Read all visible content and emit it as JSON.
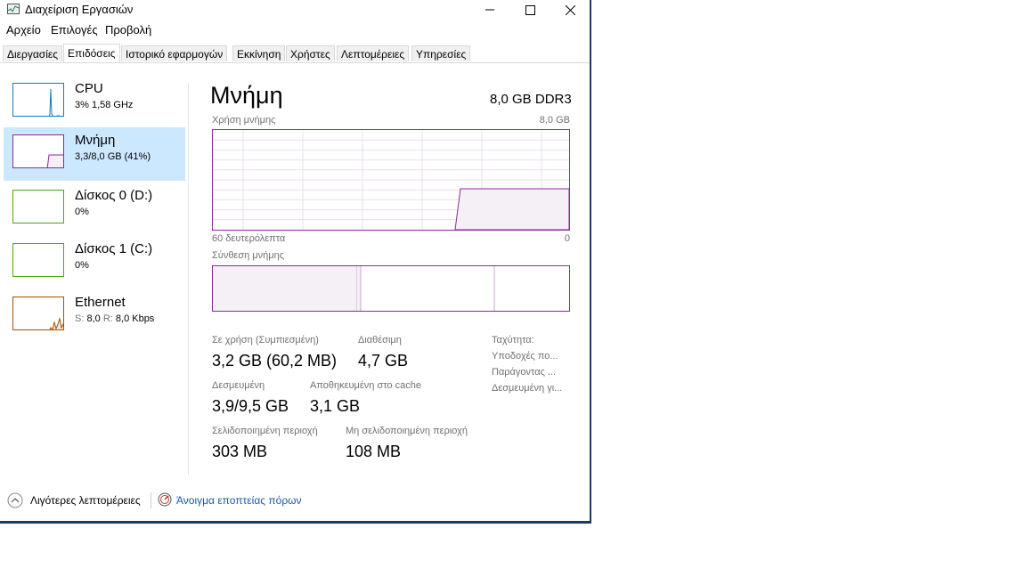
{
  "window": {
    "title": "Διαχείριση Εργασιών"
  },
  "menu": [
    "Αρχείο",
    "Επιλογές",
    "Προβολή"
  ],
  "tabs": [
    {
      "label": "Διεργασίες",
      "active": false
    },
    {
      "label": "Επιδόσεις",
      "active": true
    },
    {
      "label": "Ιστορικό εφαρμογών",
      "active": false
    },
    {
      "label": "Εκκίνηση",
      "active": false
    },
    {
      "label": "Χρήστες",
      "active": false
    },
    {
      "label": "Λεπτομέρειες",
      "active": false
    },
    {
      "label": "Υπηρεσίες",
      "active": false
    }
  ],
  "sidebar": {
    "items": [
      {
        "name": "CPU",
        "value": "3%  1,58 GHz",
        "color": "#117dbb"
      },
      {
        "name": "Μνήμη",
        "value": "3,3/8,0 GB (41%)",
        "color": "#8b2a9b",
        "selected": true
      },
      {
        "name": "Δίσκος 0 (D:)",
        "value": "0%",
        "color": "#4da60c"
      },
      {
        "name": "Δίσκος 1 (C:)",
        "value": "0%",
        "color": "#4da60c"
      },
      {
        "name": "Ethernet",
        "value_s_label": "S:",
        "value_s": "8,0",
        "value_r_label": "R:",
        "value_r": "8,0 Kbps",
        "color": "#a74f01"
      }
    ]
  },
  "main": {
    "title": "Μνήμη",
    "subtitle": "8,0 GB DDR3",
    "usage_label": "Χρήση μνήμης",
    "usage_max": "8,0 GB",
    "time_label": "60 δευτερόλεπτα",
    "time_zero": "0",
    "composition_label": "Σύνθεση μνήμης",
    "stats": {
      "in_use_label": "Σε χρήση (Συμπιεσμένη)",
      "in_use_value": "3,2 GB (60,2 MB)",
      "available_label": "Διαθέσιμη",
      "available_value": "4,7 GB",
      "committed_label": "Δεσμευμένη",
      "committed_value": "3,9/9,5 GB",
      "cached_label": "Αποθηκευμένη στο cache",
      "cached_value": "3,1 GB",
      "paged_label": "Σελιδοποιημένη περιοχή",
      "paged_value": "303 MB",
      "nonpaged_label": "Μη σελιδοποιημένη περιοχή",
      "nonpaged_value": "108 MB"
    },
    "side_stats": [
      "Ταχύτητα:",
      "Υποδοχές πο...",
      "Παράγοντας ...",
      "Δεσμευμένη γι..."
    ]
  },
  "footer": {
    "fewer_details": "Λιγότερες λεπτομέρειες",
    "resource_monitor": "Άνοιγμα εποπτείας πόρων"
  },
  "colors": {
    "memory": "#8b2a9b",
    "memory_fill": "#f4f0f6"
  }
}
